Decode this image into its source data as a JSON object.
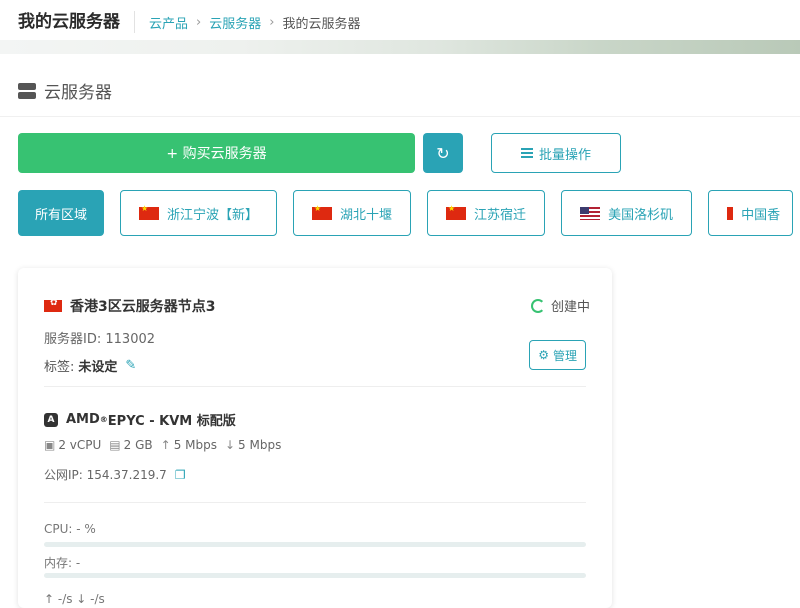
{
  "header": {
    "title": "我的云服务器",
    "breadcrumbs": [
      "云产品",
      "云服务器"
    ],
    "current": "我的云服务器",
    "sep": "›"
  },
  "section": {
    "title": "云服务器",
    "icon": "server-icon"
  },
  "actions": {
    "buy_label": "+ 购买云服务器",
    "refresh_icon": "↻",
    "batch_label": "批量操作"
  },
  "regions": [
    {
      "label": "所有区域",
      "flag": "",
      "active": true
    },
    {
      "label": "浙江宁波【新】",
      "flag": "cn"
    },
    {
      "label": "湖北十堰",
      "flag": "cn"
    },
    {
      "label": "江苏宿迁",
      "flag": "cn"
    },
    {
      "label": "美国洛杉矶",
      "flag": "us"
    },
    {
      "label": "中国香",
      "flag": "hk"
    }
  ],
  "server": {
    "name": "香港3区云服务器节点3",
    "status": "创建中",
    "id_label": "服务器ID:",
    "id": "113002",
    "tags_label": "标签:",
    "tags_value": "未设定",
    "manage_label": "管理",
    "cpu_model": "AMD",
    "cpu_model_rest": " EPYC - KVM 标配版",
    "vcpu": "2 vCPU",
    "ram": "2 GB",
    "up": "5 Mbps",
    "down": "5 Mbps",
    "ip_label": "公网IP:",
    "ip": "154.37.219.7",
    "cpu_label": "CPU: - %",
    "mem_label": "内存: -",
    "net_label": "↑ -/s   ↓ -/s"
  },
  "colors": {
    "accent": "#2aa3b5",
    "green": "#37c272"
  }
}
